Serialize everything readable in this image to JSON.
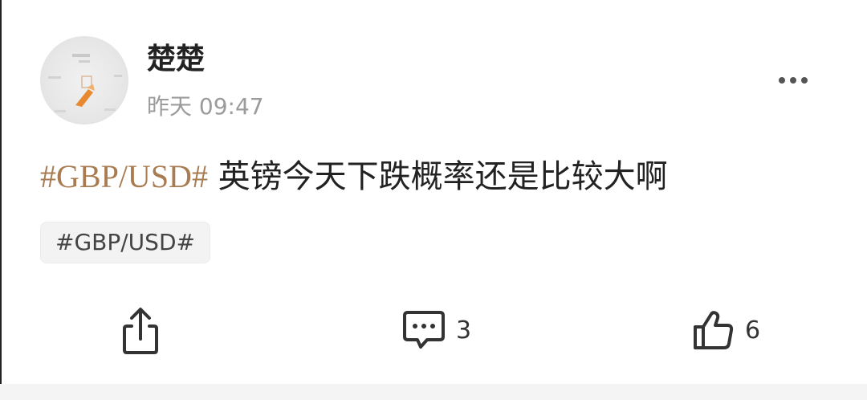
{
  "post": {
    "username": "楚楚",
    "timestamp": "昨天 09:47",
    "hashtag": "#GBP/USD#",
    "text": " 英镑今天下跌概率还是比较大啊",
    "topic_chip": "#GBP/USD#"
  },
  "actions": {
    "share_icon": "share-icon",
    "comment_icon": "comment-icon",
    "comment_count": "3",
    "like_icon": "thumbs-up-icon",
    "like_count": "6",
    "more_icon": "more-horizontal-icon"
  },
  "colors": {
    "hashtag": "#a97b50",
    "text": "#222222",
    "timestamp": "#9b9b9b",
    "background": "#f4f4f4"
  }
}
